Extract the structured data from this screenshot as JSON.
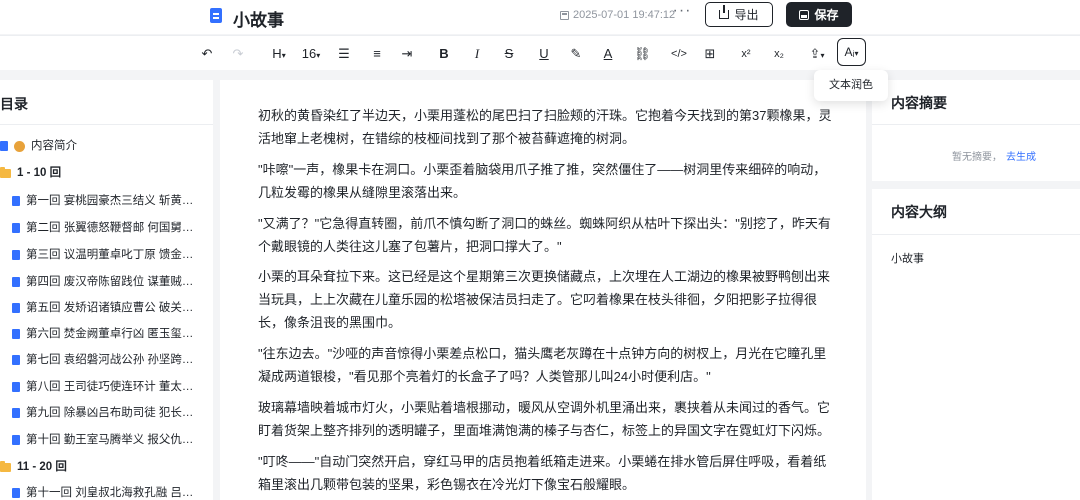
{
  "header": {
    "title": "小故事",
    "saved_time": "2025-07-01 19:47:12",
    "more_label": "···",
    "export_label": "导出",
    "save_label": "保存"
  },
  "toolbar": {
    "heading_label": "H",
    "font_size": "16",
    "caret": "▾",
    "ai_label": "Aᵢ",
    "ai_menu_item": "文本润色"
  },
  "toc": {
    "title": "目录",
    "items": [
      {
        "type": "intro",
        "label": "内容简介"
      },
      {
        "type": "folder",
        "label": "1 - 10 回"
      },
      {
        "type": "chapter",
        "label": "第一回 宴桃园豪杰三结义 斩黄…"
      },
      {
        "type": "chapter",
        "label": "第二回 张翼德怒鞭督邮 何国舅…"
      },
      {
        "type": "chapter",
        "label": "第三回 议温明董卓叱丁原 馈金…"
      },
      {
        "type": "chapter",
        "label": "第四回 废汉帝陈留践位 谋董贼…"
      },
      {
        "type": "chapter",
        "label": "第五回 发矫诏诸镇应曹公 破关…"
      },
      {
        "type": "chapter",
        "label": "第六回 焚金阙董卓行凶 匿玉玺…"
      },
      {
        "type": "chapter",
        "label": "第七回 袁绍磐河战公孙 孙坚跨…"
      },
      {
        "type": "chapter",
        "label": "第八回 王司徒巧使连环计 董太…"
      },
      {
        "type": "chapter",
        "label": "第九回 除暴凶吕布助司徒 犯长…"
      },
      {
        "type": "chapter",
        "label": "第十回 勤王室马腾举义 报父仇…"
      },
      {
        "type": "folder",
        "label": "11 - 20 回"
      },
      {
        "type": "chapter",
        "label": "第十一回 刘皇叔北海救孔融 吕…"
      }
    ]
  },
  "content": {
    "paragraphs": [
      "初秋的黄昏染红了半边天，小栗用蓬松的尾巴扫了扫脸颊的汗珠。它抱着今天找到的第37颗橡果，灵活地窜上老槐树，在错综的枝桠间找到了那个被苔藓遮掩的树洞。",
      "\"咔嚓\"一声，橡果卡在洞口。小栗歪着脑袋用爪子推了推，突然僵住了——树洞里传来细碎的响动，几粒发霉的橡果从缝隙里滚落出来。",
      "\"又满了？\"它急得直转圈，前爪不慎勾断了洞口的蛛丝。蜘蛛阿织从枯叶下探出头：\"别挖了，昨天有个戴眼镜的人类往这儿塞了包薯片，把洞口撑大了。\"",
      "小栗的耳朵耷拉下来。这已经是这个星期第三次更换储藏点，上次埋在人工湖边的橡果被野鸭刨出来当玩具，上上次藏在儿童乐园的松塔被保洁员扫走了。它叼着橡果在枝头徘徊，夕阳把影子拉得很长，像条沮丧的黑围巾。",
      "\"往东边去。\"沙哑的声音惊得小栗差点松口，猫头鹰老灰蹲在十点钟方向的树杈上，月光在它瞳孔里凝成两道银梭，\"看见那个亮着灯的长盒子了吗？人类管那儿叫24小时便利店。\"",
      "玻璃幕墙映着城市灯火，小栗贴着墙根挪动，暖风从空调外机里涌出来，裹挟着从未闻过的香气。它盯着货架上整齐排列的透明罐子，里面堆满饱满的榛子与杏仁，标签上的异国文字在霓虹灯下闪烁。",
      "\"叮咚——\"自动门突然开启，穿红马甲的店员抱着纸箱走进来。小栗蜷在排水管后屏住呼吸，看着纸箱里滚出几颗带包装的坚果，彩色锡衣在冷光灯下像宝石般耀眼。"
    ]
  },
  "summary": {
    "title": "内容摘要",
    "empty_text": "暂无摘要，",
    "generate_link": "去生成"
  },
  "outline": {
    "title": "内容大纲",
    "items": [
      "小故事"
    ]
  },
  "colors": {
    "accent": "#3370ff",
    "dark": "#1f2329",
    "folder": "#f5b841"
  }
}
